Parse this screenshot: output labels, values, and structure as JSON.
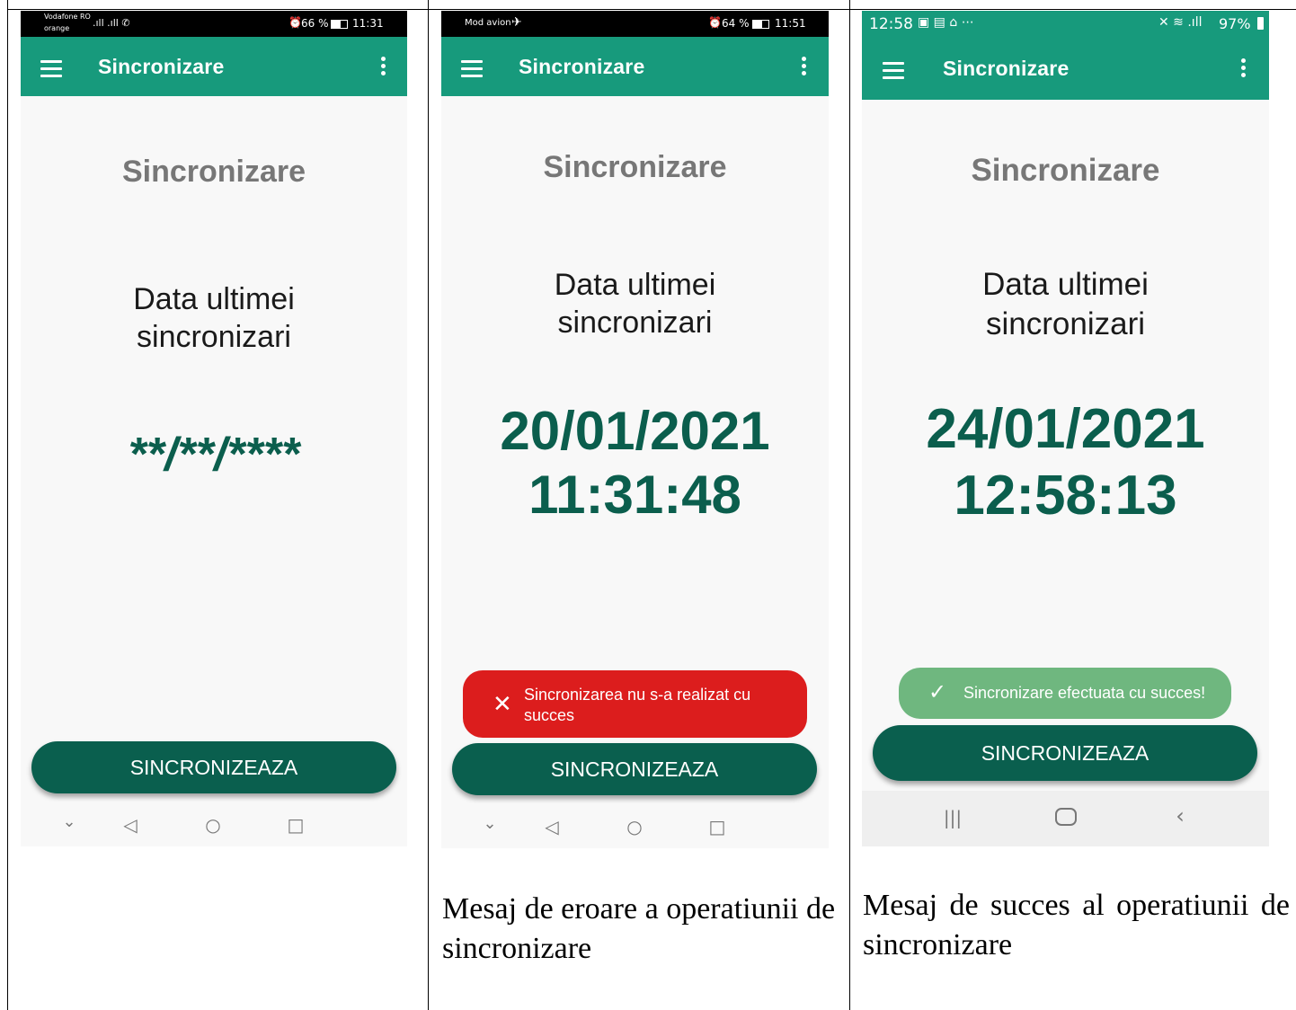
{
  "screens": [
    {
      "status": {
        "carrier": "Vodafone RO",
        "carrier2": "orange",
        "signal": "4G .ıll .ıll",
        "battery": "66 %",
        "time": "11:31"
      },
      "app_bar_title": "Sincronizare",
      "screen_title": "Sincronizare",
      "last_sync_label": "Data ultimei sincronizari",
      "date_line1": "**/**/****",
      "date_line2": "",
      "sync_button": "SINCRONIZEAZA"
    },
    {
      "status": {
        "mode": "Mod avion",
        "battery": "64 %",
        "time": "11:51"
      },
      "app_bar_title": "Sincronizare",
      "screen_title": "Sincronizare",
      "last_sync_label": "Data ultimei sincronizari",
      "date_line1": "20/01/2021",
      "date_line2": "11:31:48",
      "toast": {
        "type": "error",
        "text": "Sincronizarea nu s-a realizat cu succes",
        "color": "#dc1d1d"
      },
      "sync_button": "SINCRONIZEAZA",
      "caption": "Mesaj de eroare a operatiunii de sincronizare"
    },
    {
      "status": {
        "time": "12:58",
        "battery": "97%"
      },
      "app_bar_title": "Sincronizare",
      "screen_title": "Sincronizare",
      "last_sync_label": "Data ultimei sincronizari",
      "date_line1": "24/01/2021",
      "date_line2": "12:58:13",
      "toast": {
        "type": "success",
        "text": "Sincronizare efectuata cu succes!",
        "color": "#6fb77f"
      },
      "sync_button": "SINCRONIZEAZA",
      "caption": "Mesaj de succes al operatiunii de sincronizare"
    }
  ],
  "colors": {
    "primary": "#179a7c",
    "primary_dark": "#0a5f4e",
    "date_text": "#0b5e4d"
  }
}
